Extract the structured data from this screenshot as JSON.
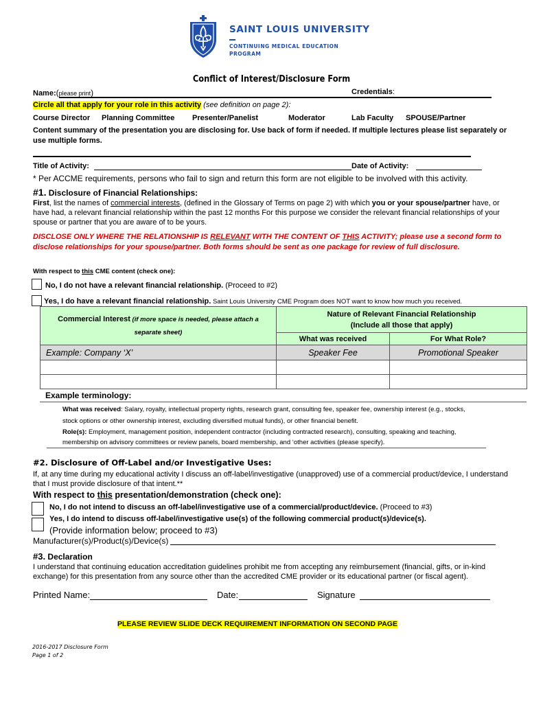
{
  "header": {
    "university": "SAINT LOUIS UNIVERSITY",
    "program_line1": "CONTINUING MEDICAL EDUCATION",
    "program_line2": "PROGRAM",
    "logo_icon": "fleur-de-lis-shield-icon",
    "brand_color": "#1f4fa8"
  },
  "form": {
    "title": "Conflict of Interest/Disclosure Form",
    "name_label": "Name:",
    "name_hint_open": "(",
    "name_hint": "please print",
    "name_hint_close": ")",
    "credentials_label": "Credentials",
    "credentials_colon": ":",
    "role_instruction": "Circle all that apply for your role in this activity",
    "role_note": " (see definition on page 2):",
    "roles": [
      "Course Director",
      "Planning Committee",
      "Presenter/Panelist",
      "Moderator",
      "Lab Faculty",
      "SPOUSE/Partner"
    ],
    "content_summary": "Content summary of the presentation you are disclosing for. Use back of form if needed.  If multiple lectures please list separately or use multiple forms.",
    "title_of_activity_label": "Title of Activity: ",
    "date_of_activity_label": "Date of Activity: ",
    "accme_note": "* Per ACCME requirements, persons who fail to sign and return this form are not eligible to be involved with this activity."
  },
  "section1": {
    "heading_num": "#1.",
    "heading": "  Disclosure of Financial Relationships:",
    "para_first": "First",
    "para_a": ", list the names of ",
    "para_link": "commercial interests",
    "para_b": ", (defined in the Glossary of Terms on page 2) with which ",
    "para_bold": "you or your spouse/partner",
    "para_c": " have, or have had, a relevant financial relationship within the past 12 months  For this purpose we consider the relevant financial relationships of your spouse or partner that you are aware of to be yours.",
    "warning_a": "DISCLOSE ONLY WHERE THE RELATIONSHIP IS ",
    "warning_u1": "RELEVANT",
    "warning_b": " WITH THE CONTENT OF ",
    "warning_u2": "THIS",
    "warning_c": " ACTIVITY; please use a second form to disclose relationships for your spouse/partner. Both forms should be sent as one package for review of full disclosure.",
    "check_prompt_a": "With respect to ",
    "check_prompt_u": "this",
    "check_prompt_b": " CME content (check one):",
    "option_no_bold": "No, I do not have a relevant financial relationship.",
    "option_no_note": " (Proceed to #2)",
    "option_yes_bold": "Yes, I do have a relevant financial relationship.",
    "option_yes_note": "  Saint Louis University CME Program does NOT want to know how much you received.",
    "table": {
      "col1_header": "Commercial Interest",
      "col1_header_note": " (if more space is needed, please attach a separate sheet)",
      "group_header_line1": "Nature of Relevant Financial Relationship",
      "group_header_line2": "(Include all those that apply)",
      "col2_header": "What was received",
      "col3_header": "For What Role?",
      "example_row": [
        "Example: Company ‘X’",
        "Speaker Fee",
        "Promotional Speaker"
      ],
      "blank_rows": 2
    },
    "terminology_heading": "Example terminology:",
    "received_label": "What was received",
    "received_text": ": Salary, royalty, intellectual property rights, research grant, consulting fee, speaker fee, ownership interest (e.g., stocks, stock options or other ownership interest, excluding diversified mutual funds), or other financial benefit.",
    "roles_label": "Role(s):",
    "roles_text": " Employment, management position, independent contractor (including contracted research), consulting, speaking and teaching, membership on advisory committees or review panels, board membership, and ‘other activities (please specify)."
  },
  "section2": {
    "heading": "#2.  Disclosure of Off-Label and/or Investigative Uses",
    "heading_colon": ":",
    "para": "If, at any time during my educational activity I discuss an off-label/investigative (unapproved) use of a commercial product/device, I understand that I must provide disclosure of that intent.**",
    "check_prompt_a": "With respect to ",
    "check_prompt_u": "this",
    "check_prompt_b": " presentation/demonstration (check one):",
    "option_no_bold": "No, I do not intend to discuss an off-label/investigative use of a commercial/product/device.",
    "option_no_note": " (Proceed to #3)",
    "option_yes_bold": "Yes, I do intend to discuss off-label/investigative use(s) of the following commercial product(s)/device(s).",
    "option_yes_note": "(Provide information below; proceed to #3)",
    "manufacturer_label": "Manufacturer(s)/Product(s)/Device(s)"
  },
  "section3": {
    "heading_num": "#3.",
    "heading": "  Declaration",
    "para": "I understand that continuing education accreditation guidelines prohibit me from accepting any reimbursement (financial, gifts, or in-kind exchange) for this presentation from any source other than the accredited CME provider or its educational partner (or fiscal agent).",
    "printed_name_label": "Printed Name:",
    "date_label": "Date:",
    "signature_label": "Signature "
  },
  "notice": "PLEASE REVIEW SLIDE DECK REQUIREMENT INFORMATION ON SECOND PAGE",
  "footer": {
    "line1": "2016-2017  Disclosure Form",
    "line2": "Page 1 of 2"
  }
}
